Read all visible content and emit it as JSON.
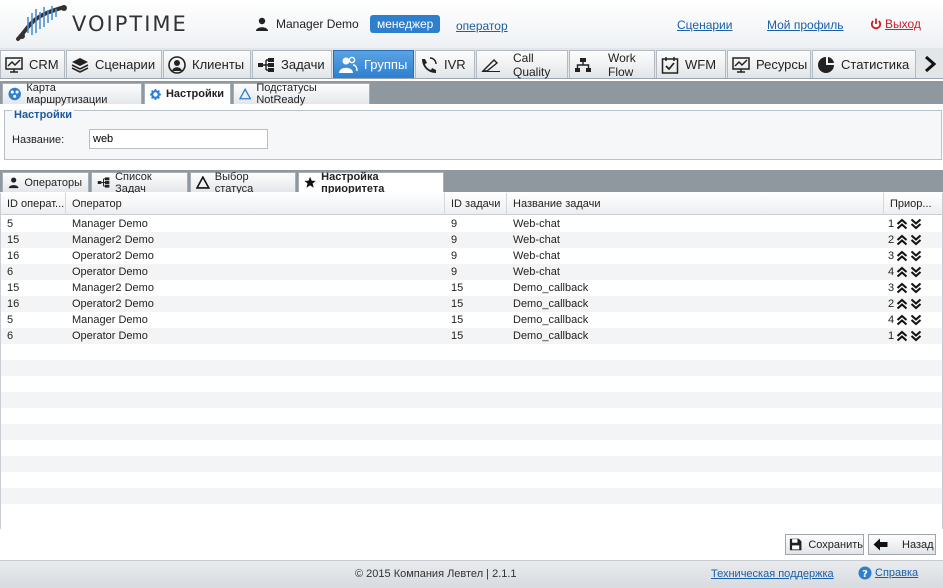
{
  "header": {
    "logo_text": "VOIPTIME",
    "user_name": "Manager Demo",
    "role_active": "менеджер",
    "role_other": "оператор",
    "links": {
      "scenarios": "Сценарии",
      "profile": "Мой профиль",
      "exit": "Выход"
    }
  },
  "main_tabs": [
    {
      "label": "CRM",
      "icon": "monitor-chart-icon"
    },
    {
      "label": "Сценарии",
      "icon": "layers-icon"
    },
    {
      "label": "Клиенты",
      "icon": "user-circle-icon"
    },
    {
      "label": "Задачи",
      "icon": "tree-icon"
    },
    {
      "label": "Группы",
      "icon": "group-icon",
      "active": true
    },
    {
      "label": "IVR",
      "icon": "ivr-icon"
    },
    {
      "label_1": "Call",
      "label_2": "Quality",
      "icon": "pen-icon"
    },
    {
      "label_1": "Work",
      "label_2": "Flow",
      "icon": "flow-icon"
    },
    {
      "label": "WFM",
      "icon": "calendar-check-icon"
    },
    {
      "label": "Ресурсы",
      "icon": "monitor-chart-icon"
    },
    {
      "label": "Статистика",
      "icon": "pie-chart-icon"
    }
  ],
  "sub_tabs": [
    {
      "label": "Карта маршрутизации",
      "icon": "routing-icon"
    },
    {
      "label": "Настройки",
      "icon": "gear-icon",
      "active": true
    },
    {
      "label": "Подстатусы NotReady",
      "icon": "triangle-icon"
    }
  ],
  "settings": {
    "legend": "Настройки",
    "name_label": "Название:",
    "name_value": "web"
  },
  "inner_tabs": [
    {
      "label": "Операторы",
      "icon": "user-icon"
    },
    {
      "label": "Список Задач",
      "icon": "tree-icon"
    },
    {
      "label": "Выбор статуса",
      "icon": "triangle-icon"
    },
    {
      "label": "Настройка приоритета",
      "icon": "star-icon",
      "active": true
    }
  ],
  "grid": {
    "columns": [
      "ID операт...",
      "Оператор",
      "ID задачи",
      "Название задачи",
      "Приор..."
    ],
    "rows": [
      [
        "5",
        "Manager Demo",
        "9",
        "Web-chat",
        "1"
      ],
      [
        "15",
        "Manager2 Demo",
        "9",
        "Web-chat",
        "2"
      ],
      [
        "16",
        "Operator2 Demo",
        "9",
        "Web-chat",
        "3"
      ],
      [
        "6",
        "Operator Demo",
        "9",
        "Web-chat",
        "4"
      ],
      [
        "15",
        "Manager2 Demo",
        "15",
        "Demo_callback",
        "3"
      ],
      [
        "16",
        "Operator2 Demo",
        "15",
        "Demo_callback",
        "2"
      ],
      [
        "5",
        "Manager Demo",
        "15",
        "Demo_callback",
        "4"
      ],
      [
        "6",
        "Operator Demo",
        "15",
        "Demo_callback",
        "1"
      ]
    ]
  },
  "buttons": {
    "save": "Сохранить",
    "back": "Назад"
  },
  "footer": {
    "copyright": "© 2015 Компания Левтел | 2.1.1",
    "support": "Техническая поддержка",
    "help": "Справка"
  },
  "colors": {
    "accent": "#2e7fce",
    "exit": "#c8202a",
    "link": "#1a5fa8",
    "tabbar": "#8f979f"
  }
}
